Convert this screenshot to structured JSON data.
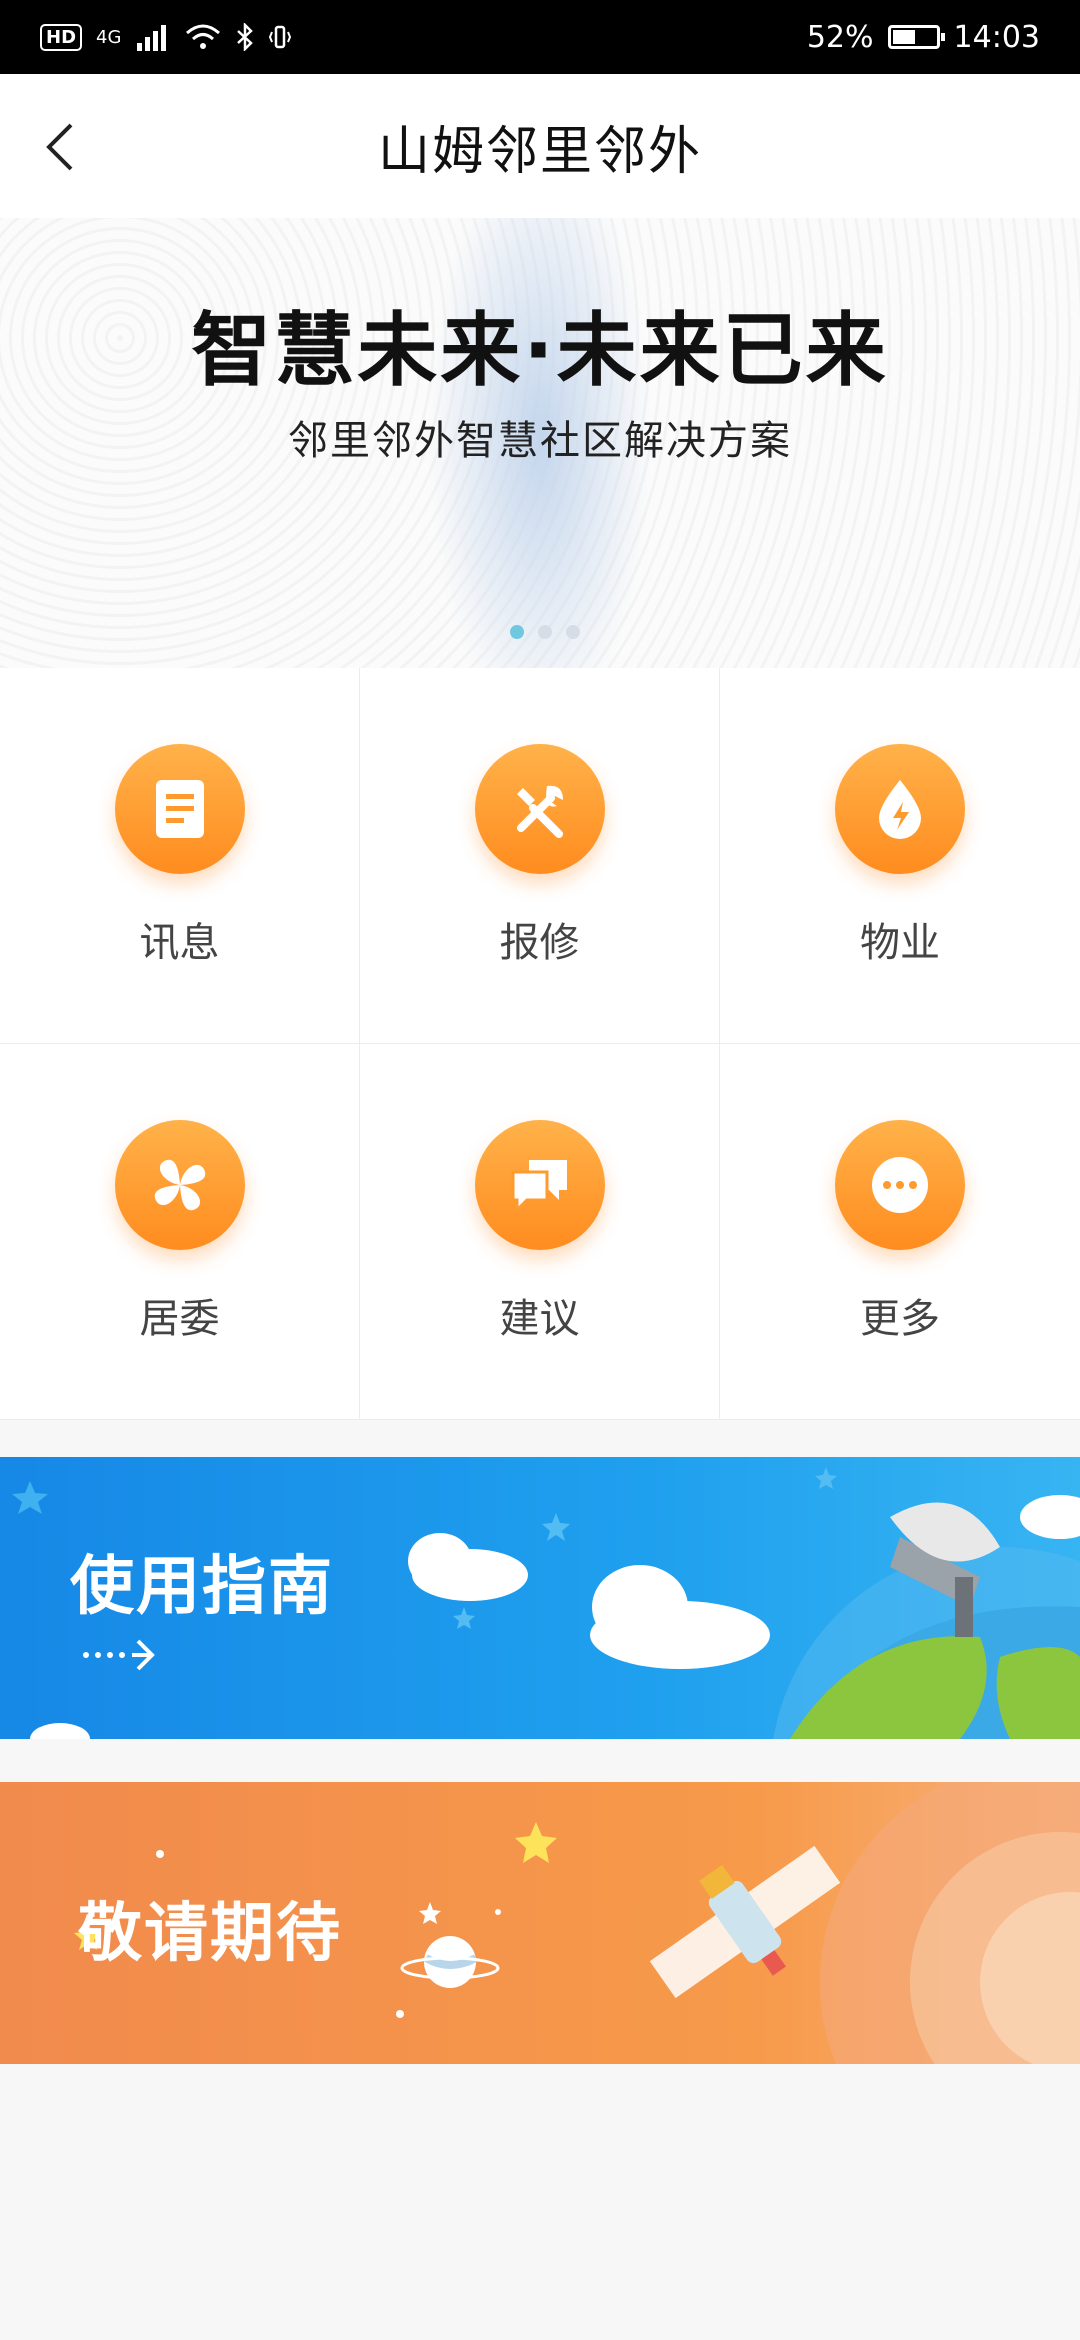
{
  "status_bar": {
    "network": "4G",
    "battery": "52%",
    "battery_level": 0.52,
    "time": "14:03"
  },
  "nav": {
    "title": "山姆邻里邻外"
  },
  "hero": {
    "title": "智慧未来·未来已来",
    "subtitle": "邻里邻外智慧社区解决方案",
    "page_count": 3,
    "active_page": 1
  },
  "grid": [
    {
      "label": "讯息",
      "icon": "document-icon"
    },
    {
      "label": "报修",
      "icon": "tools-icon"
    },
    {
      "label": "物业",
      "icon": "water-drop-icon"
    },
    {
      "label": "居委",
      "icon": "clover-icon"
    },
    {
      "label": "建议",
      "icon": "chat-bubbles-icon"
    },
    {
      "label": "更多",
      "icon": "more-dots-icon"
    }
  ],
  "banners": {
    "guide": {
      "title": "使用指南"
    },
    "coming": {
      "title": "敬请期待"
    }
  },
  "colors": {
    "accent_orange": "#ff9a2e",
    "guide_blue": "#1a93ea",
    "coming_orange": "#f4914c"
  }
}
